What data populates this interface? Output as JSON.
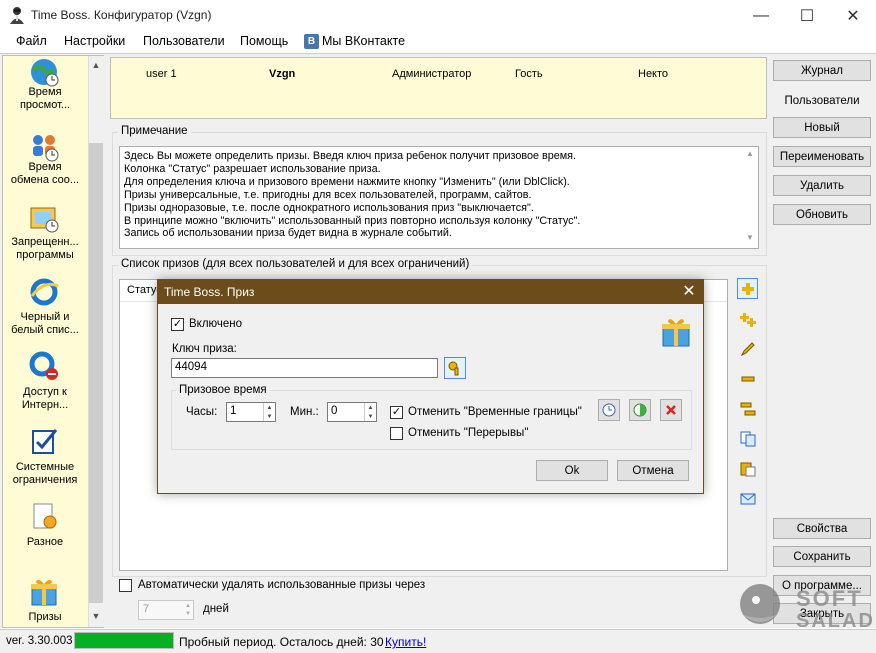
{
  "window": {
    "title": "Time Boss. Конфигуратор (Vzgn)",
    "minimize": "—",
    "maximize": "☐",
    "close": "✕"
  },
  "menu": [
    "Файл",
    "Настройки",
    "Пользователи",
    "Помощь",
    "Мы ВКонтакте"
  ],
  "vk_logo": "В",
  "sidebar": {
    "items": [
      {
        "label": "Время\nпросмот...",
        "icon": "globe-clock-icon"
      },
      {
        "label": "Время\nобмена соо...",
        "icon": "people-exchange-icon"
      },
      {
        "label": "Запрещенн...\nпрограммы",
        "icon": "blocked-programs-icon"
      },
      {
        "label": "Черный и\nбелый спис...",
        "icon": "ie-list-icon"
      },
      {
        "label": "Доступ к\nИнтерн...",
        "icon": "ie-blocked-icon"
      },
      {
        "label": "Системные\nограничения",
        "icon": "system-check-icon"
      },
      {
        "label": "Разное",
        "icon": "misc-gear-icon"
      },
      {
        "label": "Призы",
        "icon": "gift-icon"
      }
    ]
  },
  "users_header": {
    "cells": [
      "user 1",
      "Vzgn",
      "Администратор",
      "Гость",
      "Некто"
    ],
    "active": "Vzgn"
  },
  "note": {
    "title": "Примечание",
    "text": "Здесь Вы можете определить призы. Введя ключ приза ребенок получит призовое время.\nКолонка \"Статус\" разрешает использование приза.\nДля определения ключа и призового времени нажмите кнопку \"Изменить\" (или DblClick).\nПризы универсальные, т.е. пригодны для всех пользователей, программ, сайтов.\nПризы одноразовые, т.е. после однократного использования приз \"выключается\".\nВ принципе можно \"включить\" использованный приз повторно используя колонку \"Статус\".\nЗапись об использовании приза будет видна в журнале событий."
  },
  "prize_list": {
    "title": "Список призов (для всех пользователей и для всех ограничений)",
    "columns": [
      "Статус"
    ]
  },
  "toolbar_icons": [
    "add-icon",
    "add-multiple-icon",
    "edit-icon",
    "remove-icon",
    "move-icon",
    "copy-icon",
    "paste-icon",
    "email-icon"
  ],
  "right_panel": {
    "journal": "Журнал",
    "users_label": "Пользователи",
    "new": "Новый",
    "rename": "Переименовать",
    "delete": "Удалить",
    "refresh": "Обновить",
    "properties": "Свойства",
    "save": "Сохранить",
    "about": "О программе...",
    "close": "Закрыть"
  },
  "bottom": {
    "autodelete_label": "Автоматически удалять использованные призы через",
    "days_value": "7",
    "days_label": "дней"
  },
  "status": {
    "version": "ver. 3.30.003",
    "progress": 1.0,
    "trial_text": "Пробный период. Осталось дней: 30",
    "buy_link": "Купить!"
  },
  "watermark": {
    "line1": "SOFT",
    "line2": "SALAD"
  },
  "dialog": {
    "title": "Time Boss. Приз",
    "close": "✕",
    "enabled_label": "Включено",
    "enabled_checked": true,
    "key_label": "Ключ приза:",
    "key_value": "44094",
    "time_group_title": "Призовое время",
    "hours_label": "Часы:",
    "hours_value": "1",
    "minutes_label": "Мин.:",
    "minutes_value": "0",
    "cancel_time_limits_label": "Отменить \"Временные границы\"",
    "cancel_time_limits_checked": true,
    "cancel_breaks_label": "Отменить \"Перерывы\"",
    "cancel_breaks_checked": false,
    "ok": "Ok",
    "cancel": "Отмена"
  }
}
